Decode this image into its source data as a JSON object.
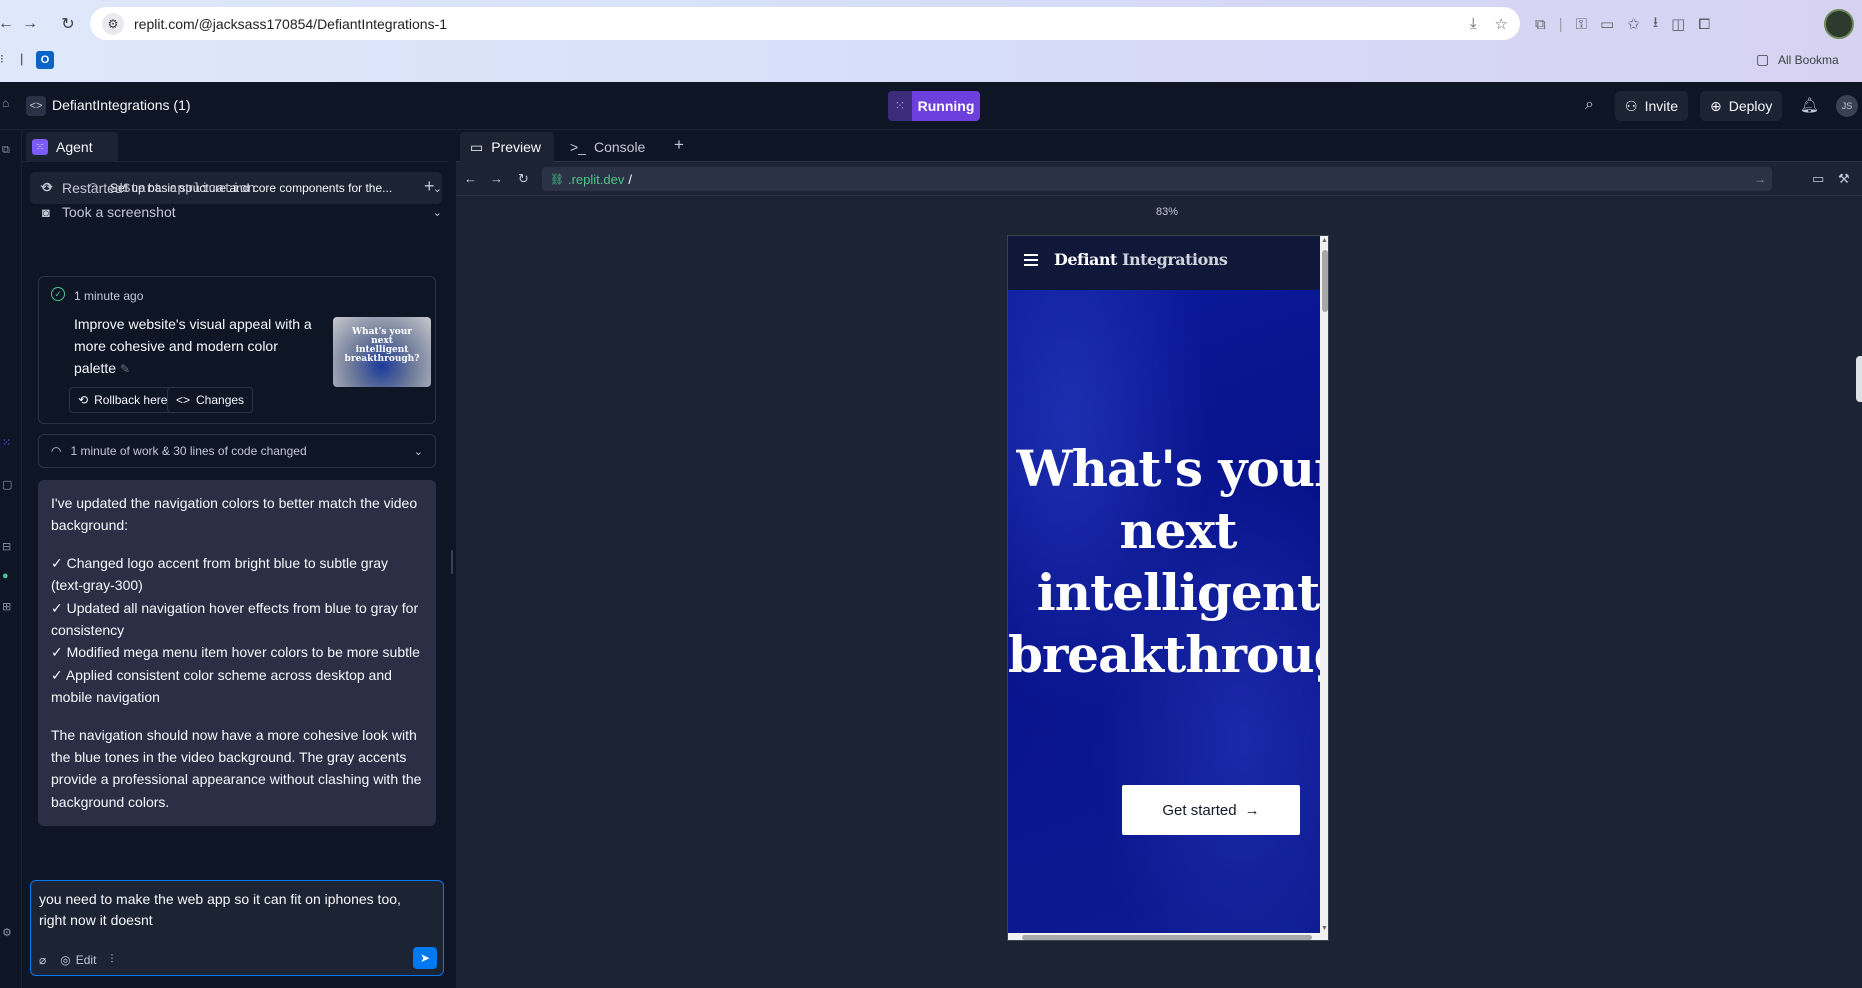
{
  "browser": {
    "url": "replit.com/@jacksass170854/DefiantIntegrations-1",
    "all_bookmarks": "All Bookma"
  },
  "header": {
    "project_name": "DefiantIntegrations (1)",
    "run_status": "Running",
    "invite_label": "Invite",
    "deploy_label": "Deploy",
    "avatar_initials": "JS"
  },
  "agent": {
    "tab_label": "Agent",
    "task_title": "Set up basic structure and core components for the...",
    "steps": [
      {
        "prefix": "Restarted ",
        "mono": "Start application"
      },
      {
        "prefix": "Took a screenshot",
        "mono": ""
      }
    ],
    "checkpoint": {
      "time": "1 minute ago",
      "description": "Improve website's visual appeal with a more cohesive and modern color palette",
      "thumbnail_text": "What's your next intelligent breakthrough?",
      "rollback_label": "Rollback here",
      "changes_label": "Changes"
    },
    "work_summary": "1 minute of work & 30 lines of code changed",
    "message": {
      "intro": "I've updated the navigation colors to better match the video background:",
      "bullets": [
        "✓ Changed logo accent from bright blue to subtle gray (text-gray-300)",
        "✓ Updated all navigation hover effects from blue to gray for consistency",
        "✓ Modified mega menu item hover colors to be more subtle",
        "✓ Applied consistent color scheme across desktop and mobile navigation"
      ],
      "outro": "The navigation should now have a more cohesive look with the blue tones in the video background. The gray accents provide a professional appearance without clashing with the background colors."
    },
    "input_text": "you need to make the web app so it can fit on iphones too, right now it doesnt",
    "edit_label": "Edit"
  },
  "preview": {
    "tabs": [
      {
        "label": "Preview"
      },
      {
        "label": "Console"
      }
    ],
    "url_domain": ".replit.dev",
    "url_path": "/",
    "zoom": "83%",
    "site": {
      "brand_main": "Defiant ",
      "brand_accent": "Integrations",
      "hero_title": "What's your\nnext\nintelligent\nbreakthrough?",
      "cta_label": "Get started"
    }
  },
  "colors": {
    "run_button": "#6d3fdd",
    "send_button": "#0079f2",
    "hero_blue": "#0a1690"
  }
}
